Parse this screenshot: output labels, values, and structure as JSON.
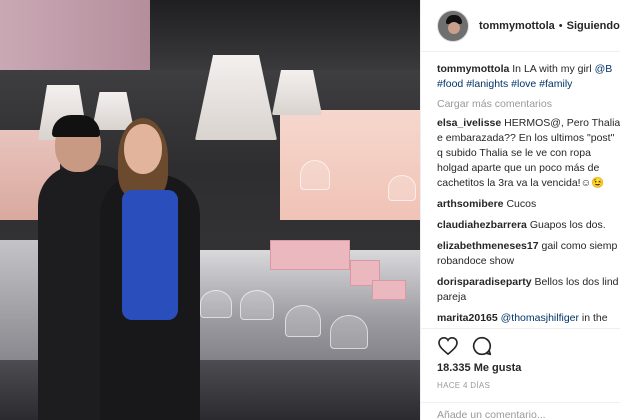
{
  "header": {
    "username": "tommymottola",
    "separator": "•",
    "follow_status": "Siguiendo"
  },
  "caption": {
    "username": "tommymottola",
    "text": "In LA with my girl",
    "mention": "@B",
    "hashtags": "#food #lanights #love #family"
  },
  "load_more": "Cargar más comentarios",
  "comments": [
    {
      "username": "elsa_ivelisse",
      "text": "HERMOS@, Pero Thalia e embarazada?? En los ultimos \"post\" q subido Thalia se le ve con ropa holgad aparte que un poco más de cachetitos la 3ra va la vencida!☺😉"
    },
    {
      "username": "arthsomibere",
      "text": "Cucos"
    },
    {
      "username": "claudiahezbarrera",
      "text": "Guapos los dos."
    },
    {
      "username": "elizabethmeneses17",
      "text": "gail como siemp robandoce show"
    },
    {
      "username": "dorisparadiseparty",
      "text": "Bellos los dos lind pareja"
    },
    {
      "username": "marita20165",
      "mention": "@thomasjhilfiger",
      "text": "in the guey"
    }
  ],
  "likes": "18.335 Me gusta",
  "timestamp": "HACE 4 DÍAS",
  "add_comment": {
    "placeholder": "Añade un comentario..."
  },
  "icons": {
    "like": "heart-icon",
    "comment": "comment-icon"
  },
  "colors": {
    "link": "#003569",
    "muted": "#999999",
    "border": "#efefef"
  }
}
